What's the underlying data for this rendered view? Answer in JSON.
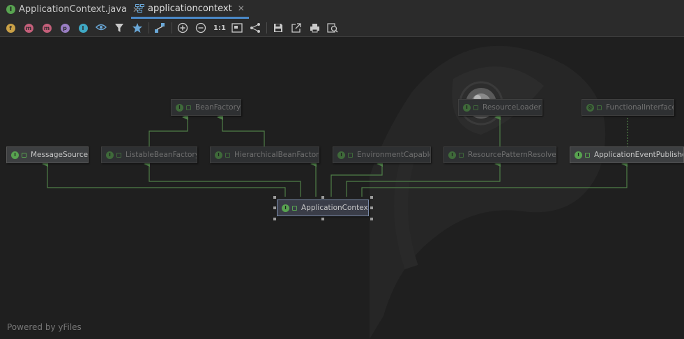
{
  "tabs": [
    {
      "label": "ApplicationContext.java",
      "icon": "interface-icon",
      "badge": "I",
      "active": false
    },
    {
      "label": "applicationcontext",
      "icon": "diagram-icon",
      "active": true
    }
  ],
  "tab_close_glyph": "✕",
  "toolbar": {
    "fields_badge": "f",
    "constructors_badge": "m",
    "methods_badge": "m",
    "properties_badge": "p",
    "inner_badge": "I",
    "actual_size": "1:1"
  },
  "nodes": {
    "beanfactory": "BeanFactory",
    "resourceloader": "ResourceLoader",
    "functionalinterface": "FunctionalInterface",
    "messagesource": "MessageSource",
    "listable": "ListableBeanFactory",
    "hierarchical": "HierarchicalBeanFactory",
    "environment": "EnvironmentCapable",
    "patternresolver": "ResourcePatternResolver",
    "eventpublisher": "ApplicationEventPublisher",
    "applicationcontext": "ApplicationContext"
  },
  "node_badge": "I",
  "node_badge_functional": "@",
  "footer": "Powered by yFiles",
  "colors": {
    "edge": "#4f7f48",
    "badge": "#58a350",
    "tab_active": "#4a88c7"
  }
}
